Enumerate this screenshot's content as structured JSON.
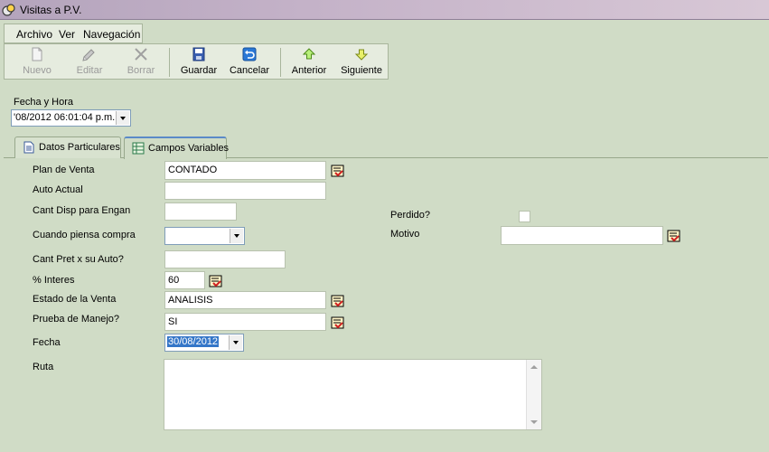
{
  "window": {
    "title": "Visitas a P.V."
  },
  "menu": [
    {
      "label": "Archivo"
    },
    {
      "label": "Ver"
    },
    {
      "label": "Navegación"
    }
  ],
  "toolbar": [
    {
      "label": "Nuevo",
      "icon": "new-document-icon",
      "enabled": false
    },
    {
      "label": "Editar",
      "icon": "edit-icon",
      "enabled": false
    },
    {
      "label": "Borrar",
      "icon": "delete-x-icon",
      "enabled": false
    },
    {
      "label": "Guardar",
      "icon": "save-disk-icon",
      "enabled": true
    },
    {
      "label": "Cancelar",
      "icon": "undo-icon",
      "enabled": true
    },
    {
      "label": "Anterior",
      "icon": "arrow-up-icon",
      "enabled": true
    },
    {
      "label": "Siguiente",
      "icon": "arrow-down-icon",
      "enabled": true
    }
  ],
  "datetime": {
    "label": "Fecha y Hora",
    "value": "'08/2012 06:01:04 p.m."
  },
  "tabs": [
    {
      "label": "Datos Particulares",
      "active": false
    },
    {
      "label": "Campos Variables",
      "active": true
    }
  ],
  "form": {
    "plan_venta": {
      "label": "Plan de Venta",
      "value": "CONTADO"
    },
    "auto_actual": {
      "label": "Auto Actual",
      "value": ""
    },
    "cant_disp": {
      "label": "Cant Disp para Engan",
      "value": ""
    },
    "cuando_compra": {
      "label": "Cuando piensa compra",
      "value": ""
    },
    "cant_pret": {
      "label": "Cant Pret x su Auto?",
      "value": ""
    },
    "interes": {
      "label": "% Interes",
      "value": "60"
    },
    "estado_venta": {
      "label": "Estado de la Venta",
      "value": "ANALISIS"
    },
    "prueba_manejo": {
      "label": "Prueba de Manejo?",
      "value": "SI"
    },
    "fecha": {
      "label": "Fecha",
      "value": "30/08/2012"
    },
    "ruta": {
      "label": "Ruta",
      "value": ""
    },
    "perdido": {
      "label": "Perdido?",
      "checked": false
    },
    "motivo": {
      "label": "Motivo",
      "value": ""
    }
  },
  "colors": {
    "background": "#d0dcc6",
    "selection": "#3476c8",
    "tab_accent": "#5b8ac8"
  }
}
